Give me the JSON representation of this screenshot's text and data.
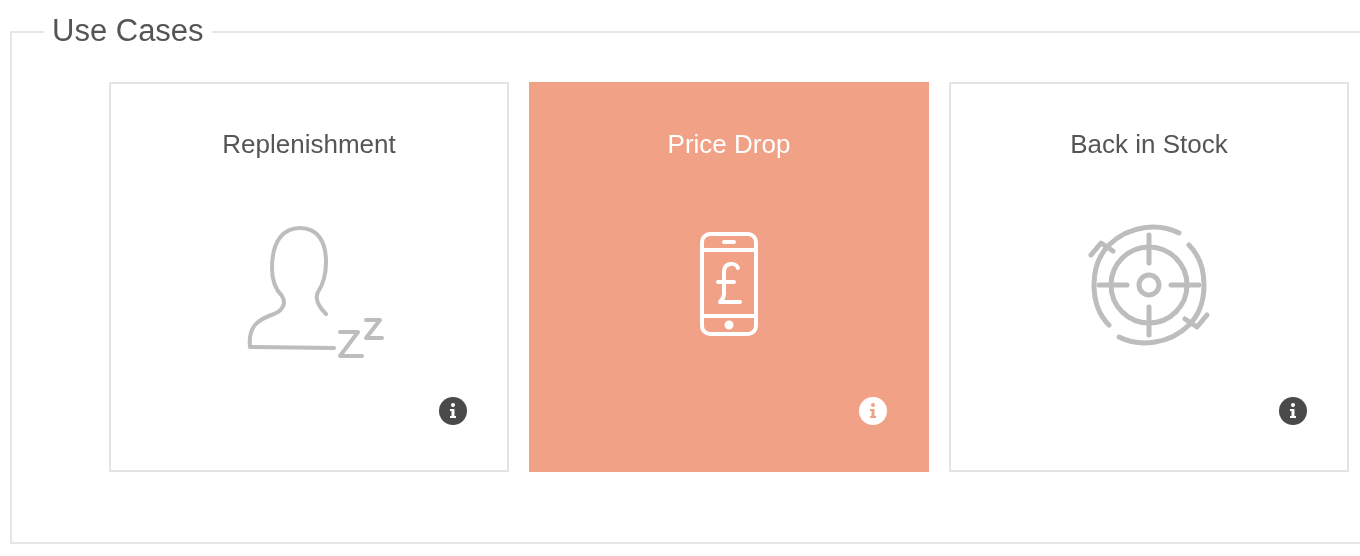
{
  "section": {
    "title": "Use Cases"
  },
  "cards": [
    {
      "title": "Replenishment",
      "selected": false
    },
    {
      "title": "Price Drop",
      "selected": true
    },
    {
      "title": "Back in Stock",
      "selected": false
    }
  ]
}
